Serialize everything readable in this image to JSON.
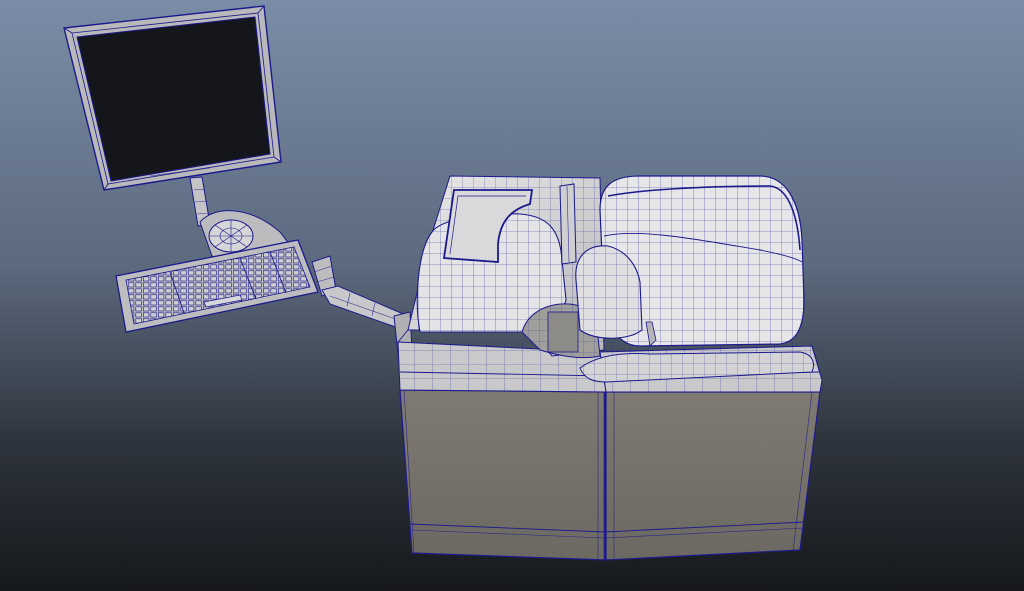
{
  "scene": {
    "background_top": "#7a8ca6",
    "background_bottom": "#16181b",
    "wireframe_color": "#1c1a8c",
    "surface_light": "#e2e2e4",
    "surface_mid": "#a9a8a6",
    "surface_dark": "#77736d",
    "screen_color": "#15161c",
    "objects": [
      "monitor",
      "monitor-arm",
      "keyboard",
      "keyboard-arm",
      "analyzer-instrument"
    ]
  }
}
